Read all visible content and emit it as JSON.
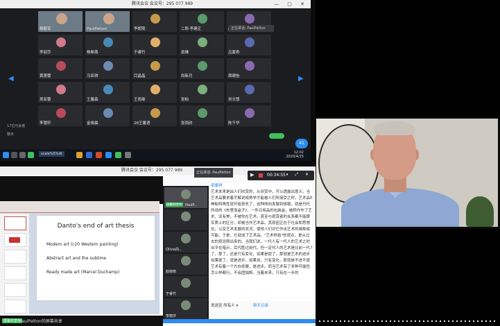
{
  "top_window": {
    "title": "腾讯会议 会议号：295 077 989",
    "window_controls": "—  ▢  ✕",
    "host_badge": "正在讲话: PaulPatton",
    "side_labels": [
      "17位与会者",
      "聊天"
    ],
    "percent": "41",
    "taskbar_app": "scale%5%dt",
    "clock_time": "12:02",
    "clock_date": "2020/4/25",
    "tiles": [
      {
        "name": "杨毅军",
        "video": true
      },
      {
        "name": "PaulPatton",
        "video": true
      },
      {
        "name": "李妮陵",
        "video": false
      },
      {
        "name": "二郎·李建正",
        "video": false
      },
      {
        "name": "赵晨",
        "video": false
      },
      {
        "name": "李丽莎",
        "video": false
      },
      {
        "name": "杨希燕",
        "video": false
      },
      {
        "name": "于睿竹",
        "video": false
      },
      {
        "name": "俞琳",
        "video": false
      },
      {
        "name": "吕蒙奇",
        "video": false
      },
      {
        "name": "黄蕾蕾",
        "video": false
      },
      {
        "name": "马亚琪",
        "video": false
      },
      {
        "name": "闫晶晶",
        "video": false
      },
      {
        "name": "尚新月",
        "video": false
      },
      {
        "name": "周珊怡",
        "video": false
      },
      {
        "name": "吴亚蕾",
        "video": false
      },
      {
        "name": "王馨森",
        "video": false
      },
      {
        "name": "王雨霏",
        "video": false
      },
      {
        "name": "张柏",
        "video": false
      },
      {
        "name": "刘文慧",
        "video": false
      },
      {
        "name": "李慧轩",
        "video": false
      },
      {
        "name": "金晓晨",
        "video": false
      },
      {
        "name": "28王馨语",
        "video": false
      },
      {
        "name": "张雨欣",
        "video": false
      },
      {
        "name": "陈千华",
        "video": false
      }
    ]
  },
  "bottom_window": {
    "title": "腾讯会议 会议号：295 077 989",
    "share_badge": "正在讲话: PaulPatton",
    "rec_time": "00:34:55",
    "rec_controls": "⏸ ⤢ ✕",
    "slide": {
      "title": "Danto's end of art thesis",
      "bullets": [
        "Modern art (c20 Western painting)",
        "Abstract art and the sublime",
        "Ready made art (Marcel Duchamp)"
      ]
    },
    "share_status_tag": "屏幕共享中",
    "share_status_text": "PaulPatton的屏幕共享",
    "cams": [
      {
        "name": "PaulP...",
        "tag": "屏幕共享中"
      },
      {
        "name": "",
        "tag": ""
      },
      {
        "name": "Olivia的...",
        "tag": ""
      },
      {
        "name": "赵晓晓",
        "tag": ""
      },
      {
        "name": "于睿竹",
        "tag": ""
      },
      {
        "name": "李丽莎",
        "tag": ""
      }
    ],
    "chat": {
      "sender": "梁馨琪",
      "lines": [
        "艺术本来是由人们欣赏的，从欣赏中，可以透露出意义。当",
        "艺术品要求着手解说成熟学才能被人们所接受之时，艺术品的",
        "神秘特殊性就开始丧失了。这种倾向发展到极致，就是丹托",
        "所说的《布里洛盒子》，一件日用品的包装盒，被称作作了艺",
        "术，没有美，不被你在艺术。甚至与观赏者的关系都不能跟",
        "实质上的区分，却被当作艺术品。其原因正在于社会和思想",
        "化，以及艺术发展的状况，使得人们对它作出艺术的阐释成",
        "可能。于是，它就成了艺术品。\"艺术终结\"的观点，是从过",
        "去的观念限出来的。当我们说，一代人有一代人的艺术之时",
        "似乎在暗示，后代胜过前代。但一定代人的艺术是比前一代人",
        "了。那了，还是只有变化，如果是提了，那就是艺术的进步",
        "如果提了，就是进步，如果说，只有变化，那就是不进不退",
        "艺术有着一个方向发展，是进步。而当艺术有了多种可能性",
        "怎么样都行，不会固独断，当着未来，只有在一步的"
      ],
      "last_line": "发送至 所有人 ▾",
      "link": "聊天记录"
    }
  }
}
